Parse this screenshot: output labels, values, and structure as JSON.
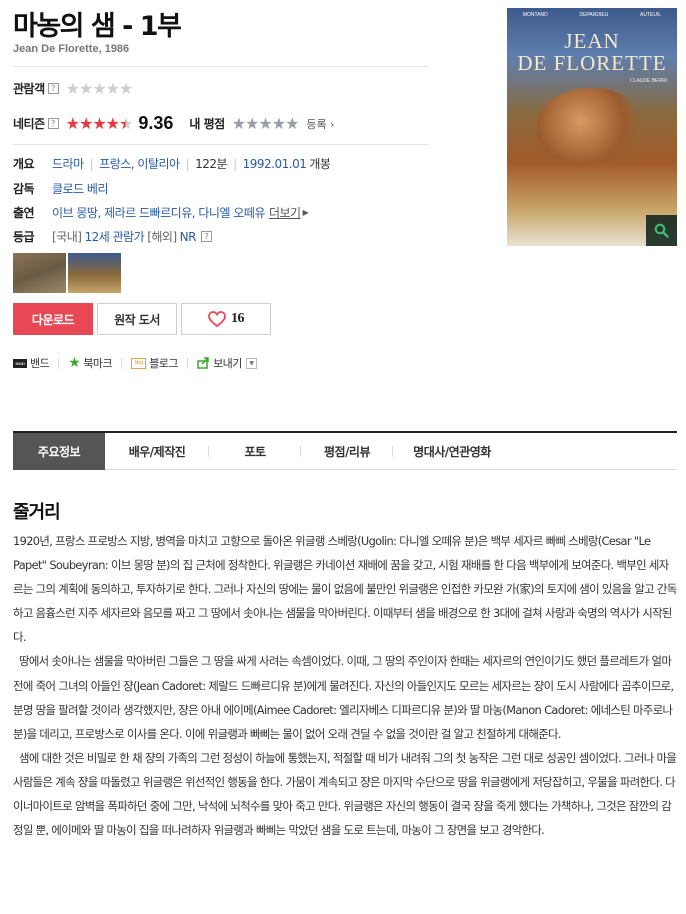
{
  "movie": {
    "title": "마농의 샘 - 1부",
    "original_title": "Jean De Florette, 1986"
  },
  "ratings": {
    "audience_label": "관람객",
    "audience_stars": 0,
    "netizen_label": "네티즌",
    "netizen_score": "9.36",
    "netizen_stars": 4.5,
    "my_rating_label": "내 평점",
    "my_stars": 0,
    "register_label": "등록",
    "help_glyph": "?"
  },
  "info": {
    "genre_label": "개요",
    "genre": "드라마",
    "country": "프랑스, 이탈리아",
    "runtime": "122분",
    "release": "1992.01.01",
    "release_suffix": "개봉",
    "director_label": "감독",
    "director": "클로드 베리",
    "cast_label": "출연",
    "cast": "이브 몽땅, 제라르 드빠르디유, 다니엘 오떼유",
    "more_label": "더보기",
    "grade_label": "등급",
    "grade_domestic_tag": "[국내]",
    "grade_domestic": "12세 관람가",
    "grade_overseas_tag": "[해외]",
    "grade_overseas": "NR"
  },
  "poster": {
    "title_line1": "JEAN",
    "title_line2": "DE FLORETTE",
    "actors": [
      "MONTAND",
      "DEPARDIEU",
      "AUTEUIL"
    ],
    "director": "CLAUDE BERRI",
    "zoom_icon": "search-icon"
  },
  "buttons": {
    "download": "다운로드",
    "book": "원작 도서",
    "like_count": "16",
    "like_icon": "heart-icon"
  },
  "share": {
    "band": "밴드",
    "bookmark": "북마크",
    "blog": "블로그",
    "send": "보내기",
    "band_icon_text": "BAND",
    "blog_icon_text": "blog"
  },
  "tabs": [
    {
      "label": "주요정보",
      "active": true
    },
    {
      "label": "배우/제작진"
    },
    {
      "label": "포토"
    },
    {
      "label": "평점/리뷰"
    },
    {
      "label": "명대사/연관영화"
    }
  ],
  "story": {
    "heading": "줄거리",
    "paragraphs": [
      "1920년, 프랑스 프로방스 지방, 병역을 마치고 고향으로 돌아온 위글랭 스베랑(Ugolin: 다니엘 오떼유 분)은 백부 세자르 빠삐 스베랑(Cesar \"Le Papet\" Soubeyran: 이브 몽땅 분)의 집 근처에 정착한다. 위글랭은 카네이션 재배에 꿈을 갖고, 시험 재배를 한 다음 백부에게 보여준다. 백부인 세자르는 그의 계획에 동의하고, 투자하기로 한다. 그러나 자신의 땅에는 물이 없음에 불만인 위글랭은 인접한 카모완 가(家)의 토지에 샘이 있음을 알고 간독하고 음흉스런 지주 세자르와 음모를 짜고 그 땅에서 솟아나는 샘물을 막아버린다. 이때부터 샘을 배경으로 한 3대에 걸쳐 사랑과 숙명의 역사가 시작된다.",
      "땅에서 솟아나는 샘물을 막아버린 그들은 그 땅을 싸게 사려는 속셈이었다. 이때, 그 땅의 주인이자 한때는 세자르의 연인이기도 했던 플르레트가 얼마 전에 죽어 그녀의 아들인 쟝(Jean Cadoret: 제랄드 드빠르디유 분)에게 물려진다. 자신의 아들인지도 모르는 세자르는 쟝이 도시 사람에다 곱추이므로, 분명 땅을 팔려할 것이라 생각했지만, 쟝은 아내 에이메(Aimee Cadoret: 엘리자베스 디파르디유 분)와 딸 마농(Manon Cadoret: 에네스틴 마주로나 분)을 데리고, 프로방스로 이사를 온다. 이에 위글랭과 빠삐는 물이 없어 오래 견딜 수 없을 것이란 걸 알고 친절하게 대해준다.",
      "샘에 대한 것은 비밀로 한 채 쟝의 가족의 그런 정성이 하늘에 통했는지, 적절할 때 비가 내려줘 그의 첫 농작은 그런 대로 성공인 셈이었다. 그러나 마을 사람들은 계속 쟝을 따돌렸고 위글랭은 위선적인 행동을 한다. 가뭄이 계속되고 쟝은 마지막 수단으로 땅을 위글랭에게 저당잡히고, 우물을 파려한다. 다이너마이트로 암벽을 폭파하던 중에 그만, 낙석에 뇌척수를 맞아 죽고 만다. 위글랭은 자신의 행동이 결국 쟝을 죽게 했다는 가책하나, 그것은 잠깐의 감정일 뿐, 에이메와 딸 마농이 집을 떠나려하자 위글랭과 빠삐는 막았던 샘을 도로 트는데, 마농이 그 장면을 보고 경악한다."
    ]
  }
}
